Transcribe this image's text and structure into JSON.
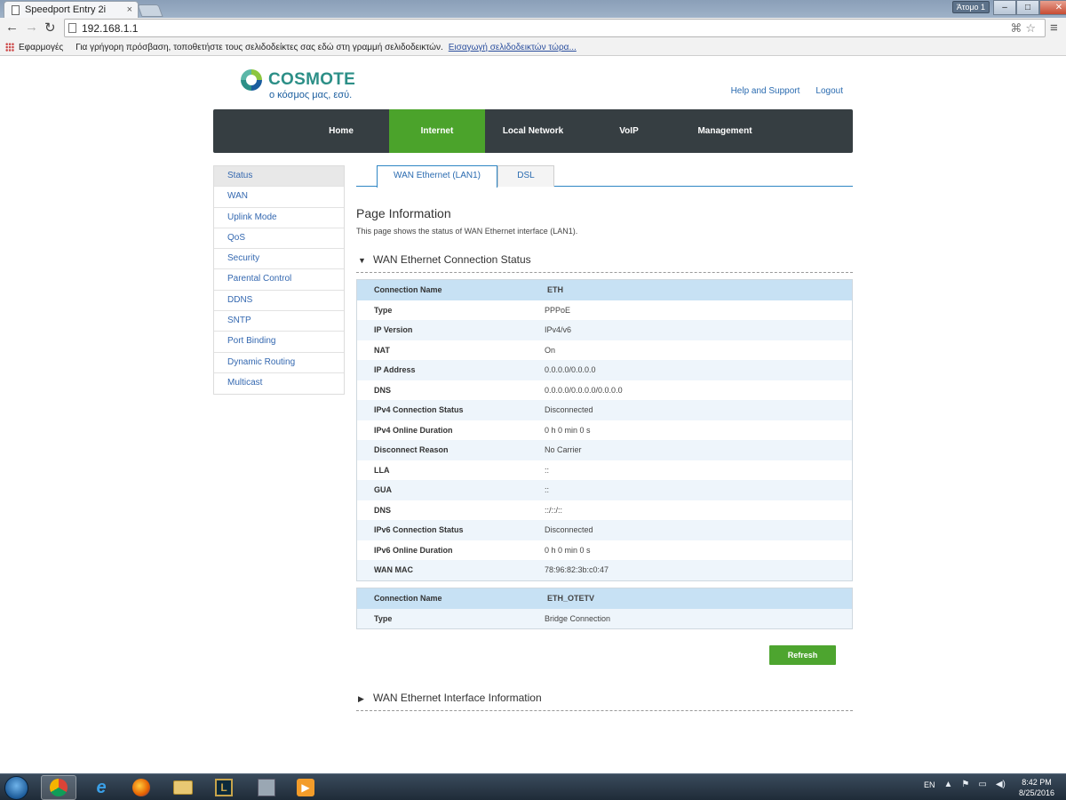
{
  "browser": {
    "tab_title": "Speedport Entry 2i",
    "tab_close": "×",
    "profile": "Άτομο 1",
    "url": "192.168.1.1",
    "bookmarks_apps": "Εφαρμογές",
    "bookmarks_hint": "Για γρήγορη πρόσβαση, τοποθετήστε τους σελιδοδείκτες σας εδώ στη γραμμή σελιδοδεικτών.",
    "bookmarks_import": "Εισαγωγή σελιδοδεικτών τώρα..."
  },
  "brand": {
    "name": "COSMOTE",
    "tagline": "ο κόσμος μας, εσύ.",
    "colors": {
      "teal": "#2c8f87",
      "blue": "#1a5d9e",
      "green": "#4ba32b"
    }
  },
  "top_links": {
    "help": "Help and Support",
    "logout": "Logout"
  },
  "main_nav": [
    "Home",
    "Internet",
    "Local Network",
    "VoIP",
    "Management"
  ],
  "main_nav_active": "Internet",
  "sidebar": [
    "Status",
    "WAN",
    "Uplink Mode",
    "QoS",
    "Security",
    "Parental Control",
    "DDNS",
    "SNTP",
    "Port Binding",
    "Dynamic Routing",
    "Multicast"
  ],
  "sidebar_active": "Status",
  "sub_tabs": [
    "WAN Ethernet (LAN1)",
    "DSL"
  ],
  "page": {
    "heading": "Page Information",
    "description": "This page shows the status of WAN Ethernet interface (LAN1).",
    "section_status": "WAN Ethernet Connection Status",
    "section_interface": "WAN Ethernet Interface Information",
    "refresh": "Refresh"
  },
  "connection_1": [
    {
      "label": "Connection Name",
      "value": "ETH"
    },
    {
      "label": "Type",
      "value": "PPPoE"
    },
    {
      "label": "IP Version",
      "value": "IPv4/v6"
    },
    {
      "label": "NAT",
      "value": "On"
    },
    {
      "label": "IP Address",
      "value": "0.0.0.0/0.0.0.0"
    },
    {
      "label": "DNS",
      "value": "0.0.0.0/0.0.0.0/0.0.0.0"
    },
    {
      "label": "IPv4 Connection Status",
      "value": "Disconnected"
    },
    {
      "label": "IPv4 Online Duration",
      "value": "0 h 0 min 0 s"
    },
    {
      "label": "Disconnect Reason",
      "value": "No Carrier"
    },
    {
      "label": "LLA",
      "value": "::"
    },
    {
      "label": "GUA",
      "value": "::"
    },
    {
      "label": "DNS",
      "value": "::/::/::"
    },
    {
      "label": "IPv6 Connection Status",
      "value": "Disconnected"
    },
    {
      "label": "IPv6 Online Duration",
      "value": "0 h 0 min 0 s"
    },
    {
      "label": "WAN MAC",
      "value": "78:96:82:3b:c0:47"
    }
  ],
  "connection_2": [
    {
      "label": "Connection Name",
      "value": "ETH_OTETV"
    },
    {
      "label": "Type",
      "value": "Bridge Connection"
    }
  ],
  "taskbar": {
    "lang": "EN",
    "time": "8:42 PM",
    "date": "8/25/2016"
  }
}
